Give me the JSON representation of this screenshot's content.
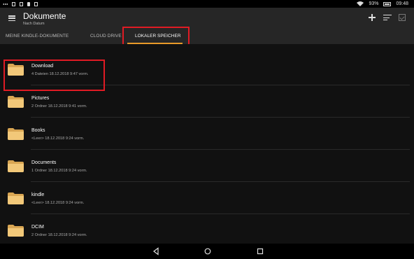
{
  "status_bar": {
    "battery": "93%",
    "time": "09:48",
    "left_icons": [
      "more-icon",
      "notification-icon",
      "download-icon",
      "lock-icon",
      "storage-icon"
    ],
    "right_icons": [
      "wifi-icon",
      "battery-icon"
    ]
  },
  "app_bar": {
    "title": "Dokumente",
    "subtitle": "Nach Datum",
    "actions": [
      "add-icon",
      "sort-icon",
      "select-icon"
    ]
  },
  "tabs": [
    {
      "label": "MEINE KINDLE-DOKUMENTE",
      "active": false
    },
    {
      "label": "CLOUD DRIVE",
      "active": false
    },
    {
      "label": "LOKALER SPEICHER",
      "active": true
    }
  ],
  "folders": [
    {
      "name": "Download",
      "meta": "4 Dateien   18.12.2018 9:47 vorm."
    },
    {
      "name": "Pictures",
      "meta": "2 Ordner   18.12.2018 9:41 vorm."
    },
    {
      "name": "Books",
      "meta": "<Leer>   18.12.2018 9:24 vorm."
    },
    {
      "name": "Documents",
      "meta": "1 Ordner   18.12.2018 9:24 vorm."
    },
    {
      "name": "kindle",
      "meta": "<Leer>   18.12.2018 9:24 vorm."
    },
    {
      "name": "DCIM",
      "meta": "2 Ordner   18.12.2018 9:24 vorm."
    }
  ],
  "nav_bar": [
    "back-icon",
    "home-icon",
    "recents-icon"
  ],
  "colors": {
    "accent": "#e89a29",
    "highlight": "#e01b24",
    "folder": "#f2c879",
    "app_bar": "#262626",
    "background": "#111111"
  }
}
